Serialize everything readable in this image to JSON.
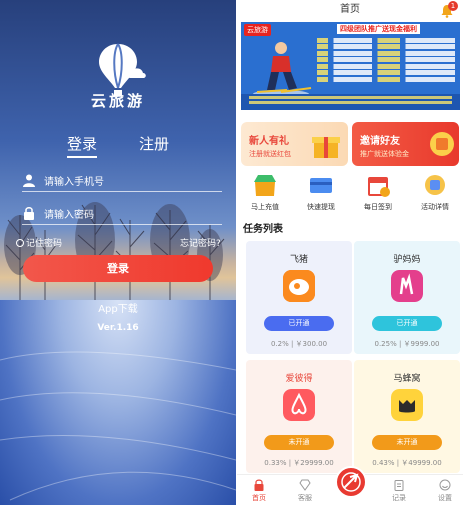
{
  "login": {
    "app_name": "云旅游",
    "tabs": [
      "登录",
      "注册"
    ],
    "phone_placeholder": "请输入手机号",
    "password_placeholder": "请输入密码",
    "remember": "记住密码",
    "forgot": "忘记密码?",
    "login_button": "登录",
    "download": "App下载",
    "version": "Ver.1.16"
  },
  "home": {
    "title": "首页",
    "notification_count": "1",
    "banner": {
      "brand": "云旅游",
      "title": "四级团队推广送现金福利"
    },
    "promos": [
      {
        "title": "新人有礼",
        "subtitle": "注册就送红包"
      },
      {
        "title": "邀请好友",
        "subtitle": "推广就送体验金"
      }
    ],
    "quick_links": [
      "马上充值",
      "快速提现",
      "每日签到",
      "活动详情"
    ],
    "section_title": "任务列表",
    "tasks": [
      {
        "name": "飞猪",
        "status": "已开通",
        "info": "0.2% | ￥300.00"
      },
      {
        "name": "驴妈妈",
        "status": "已开通",
        "info": "0.25% | ￥9999.00"
      },
      {
        "name": "爱彼得",
        "status": "未开通",
        "info": "0.33% | ￥29999.00"
      },
      {
        "name": "马蜂窝",
        "status": "未开通",
        "info": "0.43% | ￥49999.00"
      }
    ],
    "tabbar": [
      "首页",
      "客服",
      "记录",
      "设置"
    ]
  },
  "colors": {
    "accent_red": "#e8473b",
    "open_blue": "#4a6cf0",
    "open_teal": "#2ec4dc",
    "closed_orange": "#f29a1a"
  }
}
